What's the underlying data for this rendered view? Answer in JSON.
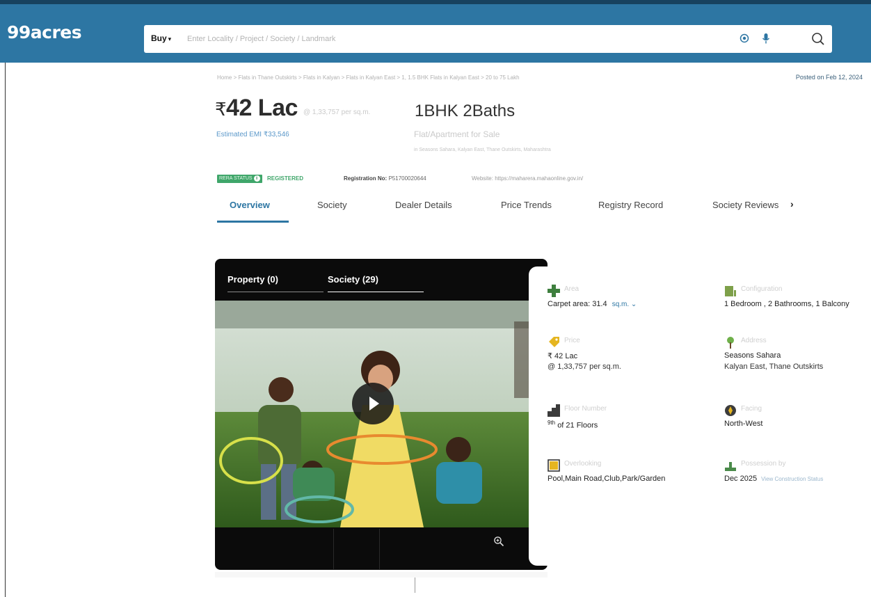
{
  "header": {
    "logo": "99acres",
    "buy_label": "Buy",
    "search_placeholder": "Enter Locality / Project / Society / Landmark"
  },
  "breadcrumb": "Home > Flats in Thane Outskirts > Flats in Kalyan > Flats in Kalyan East > 1, 1.5 BHK Flats in Kalyan East > 20 to 75 Lakh",
  "posted_on": "Posted on Feb 12, 2024",
  "price": {
    "symbol": "₹",
    "amount": "42 Lac",
    "per_sqm": "@ 1,33,757 per sq.m.",
    "emi": "Estimated EMI ₹33,546"
  },
  "listing": {
    "config": "1BHK 2Baths",
    "type": "Flat/Apartment for Sale",
    "address": "in Seasons Sahara, Kalyan East, Thane Outskirts, Maharashtra"
  },
  "rera": {
    "badge": "RERA STATUS",
    "status": "REGISTERED",
    "reg_label": "Registration No:",
    "reg_no": "P51700020644",
    "website": "Website: https://maharera.mahaonline.gov.in/"
  },
  "tabs": [
    "Overview",
    "Society",
    "Dealer Details",
    "Price Trends",
    "Registry Record",
    "Society Reviews"
  ],
  "media": {
    "tabs": [
      "Property (0)",
      "Society (29)"
    ]
  },
  "details": {
    "area": {
      "label": "Area",
      "value": "Carpet area: 31.4",
      "unit": "sq.m."
    },
    "configuration": {
      "label": "Configuration",
      "value": "1 Bedroom , 2 Bathrooms, 1 Balcony"
    },
    "price": {
      "label": "Price",
      "value": "₹ 42 Lac",
      "value2": "@ 1,33,757 per sq.m."
    },
    "address": {
      "label": "Address",
      "value": "Seasons Sahara",
      "value2": "Kalyan East, Thane Outskirts"
    },
    "floor": {
      "label": "Floor Number",
      "value_sup": "9th",
      "value": "of 21 Floors"
    },
    "facing": {
      "label": "Facing",
      "value": "North-West"
    },
    "overlooking": {
      "label": "Overlooking",
      "value": "Pool,Main Road,Club,Park/Garden"
    },
    "possession": {
      "label": "Possession by",
      "value": "Dec 2025",
      "link": "View Construction Status"
    }
  },
  "colors": {
    "brand": "#2d76a3",
    "rera_green": "#3fa66a"
  }
}
